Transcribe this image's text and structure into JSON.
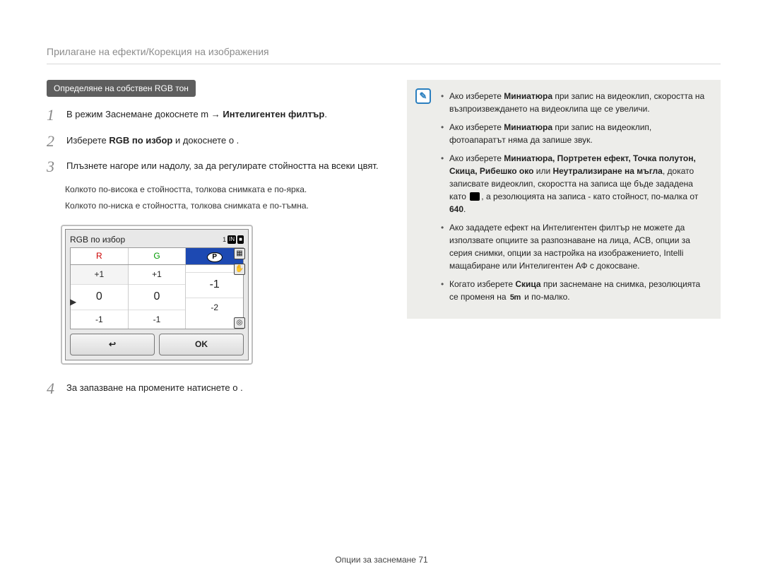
{
  "header": {
    "breadcrumb": "Прилагане на ефекти/Корекция на изображения"
  },
  "left": {
    "section_label": "Определяне на собствен RGB тон",
    "steps": [
      {
        "num": "1",
        "pre": "В режим Заснемане докоснете m  →  ",
        "bold": "Интелигентен филтър",
        "post": "."
      },
      {
        "num": "2",
        "pre": "Изберете ",
        "bold": "RGB по избор",
        "post": " и докоснете o   ."
      },
      {
        "num": "3",
        "pre": "Плъзнете нагоре или надолу, за да регулирате стойността на всеки цвят.",
        "bold": "",
        "post": ""
      },
      {
        "num": "4",
        "pre": "За запазване на промените натиснете o   .",
        "bold": "",
        "post": ""
      }
    ],
    "subtexts": [
      "Колкото по-висока е стойността, толкова снимката е по-ярка.",
      "Колкото по-ниска е стойността, толкова снимката е по-тъмна."
    ],
    "lcd": {
      "title": "RGB по избор",
      "badge_count": "1",
      "badge_icon": "IN",
      "badge_square": "■",
      "h_r": "R",
      "h_g": "G",
      "h_b": "B",
      "header_b_bubble": "P",
      "col_r": [
        "+1",
        "0",
        "-1"
      ],
      "col_g": [
        "+1",
        "0",
        "-1"
      ],
      "col_b": [
        "",
        "-1",
        "-2"
      ],
      "ok": "OK"
    }
  },
  "right": {
    "notes": {
      "items": [
        {
          "plain_before": "Ако изберете ",
          "bold": "Миниатюра",
          "plain_after": " при запис на видеоклип, скоростта на възпроизвеждането на видеоклипа ще се увеличи."
        },
        {
          "plain_before": "Ако изберете ",
          "bold": "Миниатюра",
          "plain_after": " при запис на видеоклип, фотоапаратът няма да запише звук."
        },
        {
          "plain_before": "Ако изберете ",
          "bold": "Миниатюра, Портретен ефект, Точка полутон, Скица, Рибешко око",
          "plain_middle": " или ",
          "bold2": "Неутрализиране на мъгла",
          "plain_after1": ", докато записвате видеоклип, скоростта на записа ще бъде зададена като ",
          "icon": true,
          "plain_after2": ", а резолюцията на записа - като стойност, по-малка от ",
          "bold3": "640",
          "plain_after3": "."
        },
        {
          "plain_before": "Ако зададете ефект на Интелигентен филтър не можете да използвате опциите за разпознаване на лица, ACB, опции за серия снимки, опции за настройка на изображението, Intelli мащабиране или Интелигентен АФ с докосване."
        },
        {
          "plain_before": "Когато изберете ",
          "bold": "Скица",
          "plain_after1": " при заснемане на снимка, резолюцията се променя на ",
          "iconlabel": "5m",
          "plain_after2": " и по-малко."
        }
      ]
    }
  },
  "footer": {
    "label": "Опции за заснемане  71"
  }
}
